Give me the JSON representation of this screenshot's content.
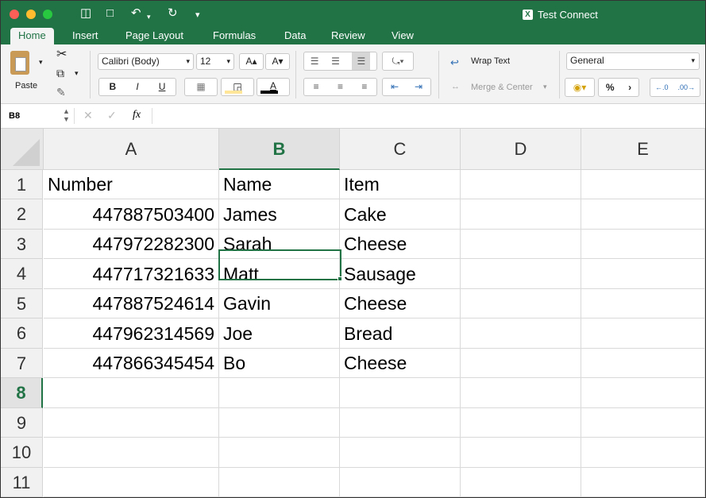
{
  "window": {
    "title": "Test Connect",
    "app_icon": "excel-icon"
  },
  "tabs": [
    "Home",
    "Insert",
    "Page Layout",
    "Formulas",
    "Data",
    "Review",
    "View"
  ],
  "ribbon": {
    "paste_label": "Paste",
    "font_name": "Calibri (Body)",
    "font_size": "12",
    "wrap_text": "Wrap Text",
    "merge_center": "Merge & Center",
    "number_format": "General",
    "bold": "B",
    "italic": "I",
    "underline": "U",
    "percent": "%",
    "comma": "›",
    "increase_font": "A▴",
    "decrease_font": "A▾",
    "font_color": "A"
  },
  "formula_bar": {
    "name_box": "B8",
    "fx": "fx",
    "value": ""
  },
  "columns": [
    "A",
    "B",
    "C",
    "D",
    "E"
  ],
  "rows": [
    "1",
    "2",
    "3",
    "4",
    "5",
    "6",
    "7",
    "8",
    "9",
    "10",
    "11"
  ],
  "selected": {
    "column": "B",
    "row": "8"
  },
  "cells": {
    "header": [
      "Number",
      "Name",
      "Item"
    ],
    "data": [
      [
        "447887503400",
        "James",
        "Cake"
      ],
      [
        "447972282300",
        "Sarah",
        "Cheese"
      ],
      [
        "447717321633",
        "Matt",
        "Sausage"
      ],
      [
        "447887524614",
        "Gavin",
        "Cheese"
      ],
      [
        "447962314569",
        "Joe",
        "Bread"
      ],
      [
        "447866345454",
        "Bo",
        "Cheese"
      ]
    ]
  },
  "colors": {
    "accent": "#217346",
    "ribbon": "#f3f3f3",
    "header": "#f1f1f1",
    "grid": "#d9d9d9"
  }
}
